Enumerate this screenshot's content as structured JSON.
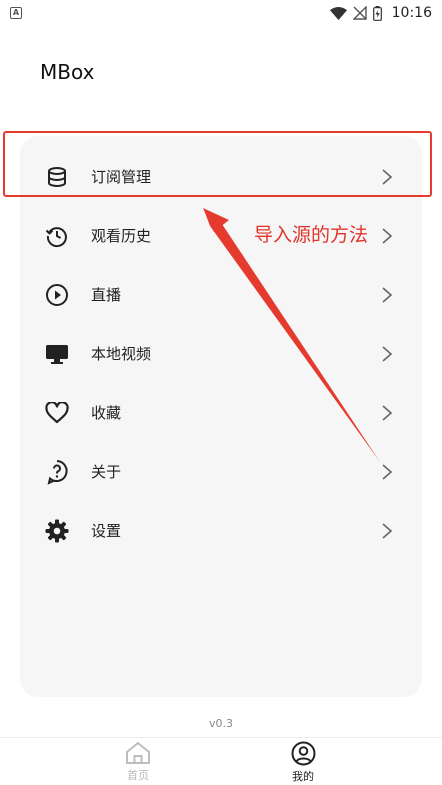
{
  "status_bar": {
    "notification_icon": "a-notification-icon",
    "notification_letter": "A",
    "icons": [
      "wifi-icon",
      "signal-off-icon",
      "battery-icon"
    ],
    "time": "10:16"
  },
  "app": {
    "title": "MBox"
  },
  "menu": {
    "items": [
      {
        "icon": "database-icon",
        "label": "订阅管理"
      },
      {
        "icon": "history-icon",
        "label": "观看历史"
      },
      {
        "icon": "play-circle-icon",
        "label": "直播"
      },
      {
        "icon": "monitor-icon",
        "label": "本地视频"
      },
      {
        "icon": "heart-icon",
        "label": "收藏"
      },
      {
        "icon": "help-circle-icon",
        "label": "关于"
      },
      {
        "icon": "gear-icon",
        "label": "设置"
      }
    ]
  },
  "annotation": {
    "text": "导入源的方法",
    "color": "#e53b2e"
  },
  "version": "v0.3",
  "bottom_nav": {
    "items": [
      {
        "icon": "home-icon",
        "label": "首页",
        "active": false
      },
      {
        "icon": "user-circle-icon",
        "label": "我的",
        "active": true
      }
    ]
  }
}
